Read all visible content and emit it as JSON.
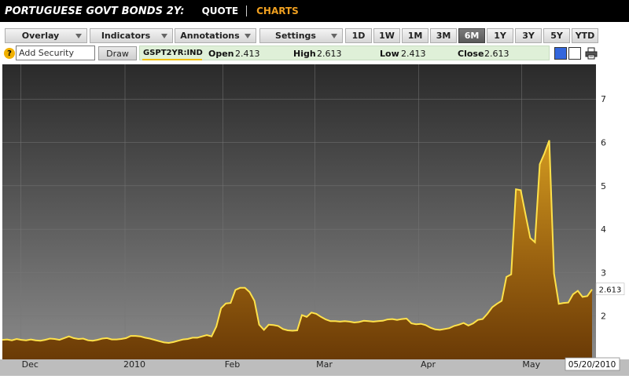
{
  "header": {
    "title": "PORTUGUESE GOVT BONDS 2Y:",
    "quote_link": "QUOTE",
    "charts_link": "CHARTS"
  },
  "toolbar": {
    "menus": [
      "Overlay",
      "Indicators",
      "Annotations",
      "Settings"
    ],
    "ranges": [
      "1D",
      "1W",
      "1M",
      "3M",
      "6M",
      "1Y",
      "3Y",
      "5Y",
      "YTD"
    ],
    "active_range": "6M"
  },
  "security_bar": {
    "help_icon": "?",
    "add_security_value": "Add Security",
    "draw_label": "Draw",
    "symbol": "GSPT2YR:IND",
    "open_label": "Open",
    "open_value": "2.413",
    "high_label": "High",
    "high_value": "2.613",
    "low_label": "Low",
    "low_value": "2.413",
    "close_label": "Close",
    "close_value": "2.613"
  },
  "colors": {
    "accent": "#f0a020",
    "line": "#ffe24a",
    "active_button": "#5a5a5a",
    "swatch_blue": "#3366dd"
  },
  "chart_data": {
    "type": "area",
    "series": [
      {
        "name": "GSPT2YR:IND",
        "values": [
          1.45,
          1.46,
          1.44,
          1.47,
          1.45,
          1.44,
          1.46,
          1.44,
          1.43,
          1.45,
          1.48,
          1.47,
          1.45,
          1.49,
          1.53,
          1.49,
          1.47,
          1.48,
          1.44,
          1.43,
          1.45,
          1.48,
          1.49,
          1.46,
          1.46,
          1.47,
          1.49,
          1.54,
          1.54,
          1.53,
          1.5,
          1.48,
          1.45,
          1.42,
          1.39,
          1.38,
          1.4,
          1.43,
          1.46,
          1.47,
          1.5,
          1.5,
          1.53,
          1.56,
          1.53,
          1.76,
          2.18,
          2.29,
          2.3,
          2.6,
          2.65,
          2.65,
          2.55,
          2.35,
          1.8,
          1.68,
          1.8,
          1.79,
          1.77,
          1.7,
          1.67,
          1.66,
          1.67,
          2.02,
          1.98,
          2.08,
          2.05,
          1.98,
          1.92,
          1.88,
          1.88,
          1.87,
          1.88,
          1.87,
          1.85,
          1.86,
          1.89,
          1.88,
          1.87,
          1.88,
          1.89,
          1.92,
          1.93,
          1.91,
          1.93,
          1.94,
          1.83,
          1.81,
          1.82,
          1.79,
          1.73,
          1.69,
          1.68,
          1.7,
          1.72,
          1.77,
          1.8,
          1.84,
          1.78,
          1.83,
          1.91,
          1.93,
          2.05,
          2.2,
          2.28,
          2.35,
          2.9,
          2.96,
          4.92,
          4.9,
          4.35,
          3.8,
          3.7,
          5.5,
          5.75,
          6.05,
          2.98,
          2.28,
          2.3,
          2.31,
          2.5,
          2.58,
          2.44,
          2.46,
          2.613
        ]
      }
    ],
    "x_labels": [
      "Dec",
      "2010",
      "Feb",
      "Mar",
      "Apr",
      "May"
    ],
    "y_ticks": [
      "2",
      "3",
      "4",
      "5",
      "6",
      "7"
    ],
    "ylim": [
      1.0,
      7.8
    ],
    "last_value_label": "2.613",
    "date_label": "05/20/2010",
    "grid": true
  }
}
